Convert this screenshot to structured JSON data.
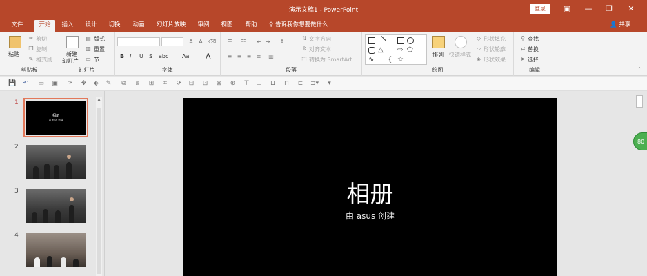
{
  "window": {
    "title": "演示文稿1 - PowerPoint",
    "login_label": "登录"
  },
  "tabs": [
    "文件",
    "开始",
    "插入",
    "设计",
    "切换",
    "动画",
    "幻灯片放映",
    "审阅",
    "视图",
    "帮助"
  ],
  "active_tab": "开始",
  "tell_me": "告诉我你想要做什么",
  "share_label": "共享",
  "ribbon": {
    "clipboard": {
      "label": "剪贴板",
      "paste": "粘贴",
      "cut": "剪切",
      "copy": "复制",
      "format_painter": "格式刷"
    },
    "slides": {
      "label": "幻灯片",
      "new_slide_1": "新建",
      "new_slide_2": "幻灯片",
      "layout": "版式",
      "reset": "重置",
      "section": "节"
    },
    "font": {
      "label": "字体",
      "bold": "B",
      "italic": "I",
      "underline": "U",
      "strike": "S",
      "spacing": "abc",
      "case": "Aa",
      "grow": "A",
      "shrink": "A"
    },
    "paragraph": {
      "label": "段落",
      "text_direction": "文字方向",
      "align_text": "对齐文本",
      "smartart": "转换为 SmartArt"
    },
    "drawing": {
      "label": "绘图",
      "arrange": "排列",
      "quick_styles": "快速样式",
      "shape_fill": "形状填充",
      "shape_outline": "形状轮廓",
      "shape_effects": "形状效果"
    },
    "editing": {
      "label": "编辑",
      "find": "查找",
      "replace": "替换",
      "select": "选择"
    }
  },
  "slides": [
    {
      "number": "1",
      "title": "相册",
      "subtitle": "由 asus 创建"
    },
    {
      "number": "2"
    },
    {
      "number": "3"
    },
    {
      "number": "4"
    }
  ],
  "current_slide": {
    "title": "相册",
    "subtitle": "由 asus 创建"
  },
  "badge": "80",
  "colors": {
    "accent": "#b7472a",
    "selection": "#e2785a"
  }
}
